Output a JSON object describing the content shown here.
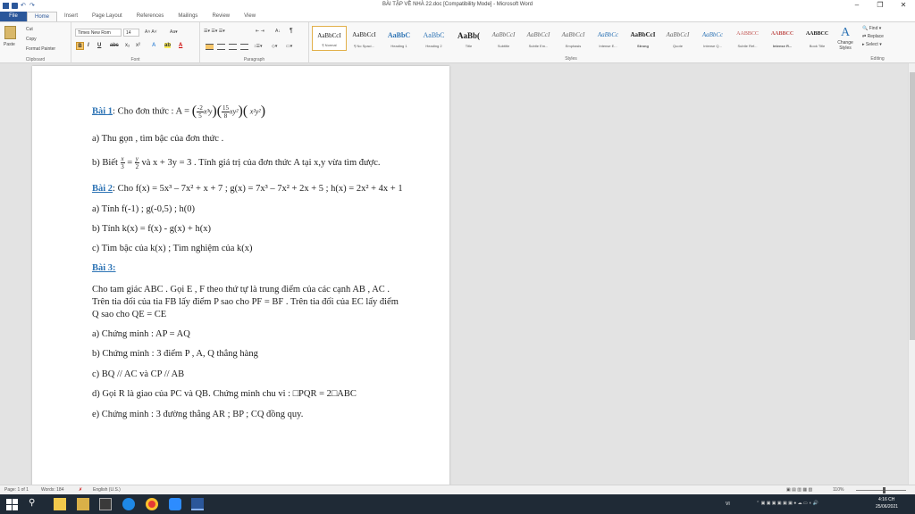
{
  "window": {
    "title": "BÀI TẬP VỀ NHÀ 22.doc [Compatibility Mode] - Microsoft Word",
    "controls": [
      "–",
      "❐",
      "✕"
    ]
  },
  "tabs": [
    "File",
    "Home",
    "Insert",
    "Page Layout",
    "References",
    "Mailings",
    "Review",
    "View"
  ],
  "ribbon": {
    "clipboard": {
      "paste": "Paste",
      "cut": "Cut",
      "copy": "Copy",
      "format_painter": "Format Painter",
      "label": "Clipboard"
    },
    "font": {
      "name": "Times New Rom",
      "size": "14",
      "label": "Font"
    },
    "paragraph": {
      "label": "Paragraph"
    },
    "styles": {
      "label": "Styles",
      "items": [
        {
          "sample": "AaBbCcI",
          "name": "¶ Normal"
        },
        {
          "sample": "AaBbCcI",
          "name": "¶ No Spaci..."
        },
        {
          "sample": "AaBbC",
          "name": "Heading 1"
        },
        {
          "sample": "AaBbC",
          "name": "Heading 2"
        },
        {
          "sample": "AaBb(",
          "name": "Title"
        },
        {
          "sample": "AaBbCcI",
          "name": "Subtitle"
        },
        {
          "sample": "AaBbCcI",
          "name": "Subtle Em..."
        },
        {
          "sample": "AaBbCcI",
          "name": "Emphasis"
        },
        {
          "sample": "AaBbCc",
          "name": "Intense E..."
        },
        {
          "sample": "AaBbCcI",
          "name": "Strong"
        },
        {
          "sample": "AaBbCcI",
          "name": "Quote"
        },
        {
          "sample": "AaBbCc",
          "name": "Intense Q..."
        },
        {
          "sample": "AABBCC",
          "name": "Subtle Ref..."
        },
        {
          "sample": "AABBCC",
          "name": "Intense R..."
        },
        {
          "sample": "AABBCC",
          "name": "Book Title"
        }
      ],
      "change_styles": "Change Styles"
    },
    "editing": {
      "find": "Find",
      "replace": "Replace",
      "select": "Select",
      "label": "Editing"
    }
  },
  "document": {
    "bai1_title": "Bài 1",
    "bai1_text": ": Cho đơn thức : A =",
    "bai1_a": "a) Thu gọn , tìm bậc của đơn thức .",
    "bai1_b_pre": "b) Biết",
    "bai1_b_post": "và x + 3y = 3 . Tính giá trị của đơn thức A tại x,y vừa tìm được.",
    "bai2_title": "Bài 2",
    "bai2_text": ": Cho f(x) = 5x³ – 7x² + x + 7 ; g(x) = 7x³ – 7x² + 2x + 5 ; h(x) = 2x² + 4x + 1",
    "bai2_a": "a) Tính f(-1) ; g(-0,5) ; h(0)",
    "bai2_b": "b) Tính k(x) = f(x) - g(x) + h(x)",
    "bai2_c": "c) Tìm bậc của k(x) ; Tìm nghiệm của k(x)",
    "bai3_title": "Bài 3:",
    "bai3_p1": "Cho tam giác ABC . Gọi E , F theo thứ tự là trung điểm của các cạnh AB , AC .",
    "bai3_p2": "Trên tia đối của tia FB lấy điểm P sao cho PF = BF . Trên tia đối của EC lấy điểm",
    "bai3_p3": "Q sao cho QE = CE",
    "bai3_a": "a) Chứng minh : AP = AQ",
    "bai3_b": "b) Chứng minh : 3 điểm P , A, Q thẳng hàng",
    "bai3_c": "c) BQ // AC và CP // AB",
    "bai3_d": "d) Gọi R là giao của PC và QB. Chứng minh chu vi :  □PQR = 2□ABC",
    "bai3_e": "e) Chứng minh : 3 đường thẳng AR ; BP ; CQ đồng quy."
  },
  "statusbar": {
    "page": "Page: 1 of 1",
    "words": "Words: 184",
    "language": "English (U.S.)",
    "zoom": "110%"
  },
  "taskbar": {
    "lang": "VI",
    "time": "4:16 CH",
    "date": "25/06/2021"
  }
}
